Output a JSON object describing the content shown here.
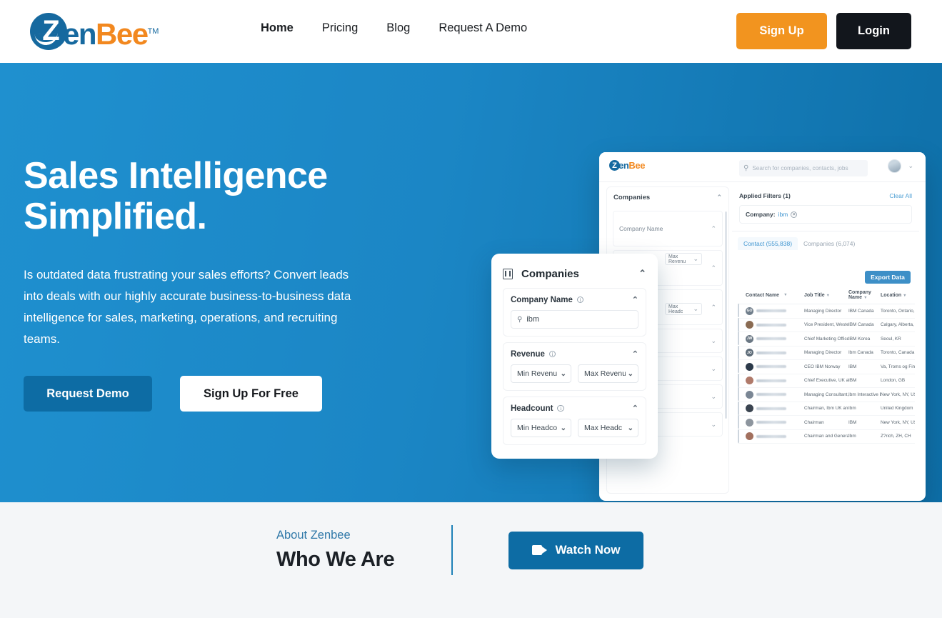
{
  "header": {
    "logo": {
      "z": "Z",
      "en": "en",
      "bee": "Bee",
      "tm": "TM"
    },
    "nav": [
      {
        "label": "Home",
        "active": true
      },
      {
        "label": "Pricing",
        "active": false
      },
      {
        "label": "Blog",
        "active": false
      },
      {
        "label": "Request A Demo",
        "active": false
      }
    ],
    "signup_label": "Sign Up",
    "login_label": "Login"
  },
  "hero": {
    "title_line1": "Sales Intelligence",
    "title_line2": "Simplified.",
    "paragraph": "Is outdated data frustrating your sales efforts? Convert leads into deals with our highly accurate business-to-business data intelligence for sales, marketing, operations, and recruiting teams.",
    "cta_primary": "Request Demo",
    "cta_secondary": "Sign Up For Free",
    "bg_color": "#1b86c5"
  },
  "mockup": {
    "logo": {
      "z": "Z",
      "en": "en",
      "bee": "Bee"
    },
    "search_placeholder": "Search for companies, contacts, jobs",
    "sidebar": {
      "title": "Companies",
      "sections": [
        {
          "label": "Company Name",
          "chev": "chevron-up"
        },
        {
          "label": "Revenue",
          "chev": "chevron-up"
        },
        {
          "label": "Headcount",
          "chev": "chevron-up"
        },
        {
          "label": "",
          "chev": "chevron-down"
        },
        {
          "label": "",
          "chev": "chevron-down"
        },
        {
          "label": "",
          "chev": "chevron-down"
        },
        {
          "label": "",
          "chev": "chevron-down"
        }
      ],
      "max_revenue_pill": "Max Revenu",
      "max_headcount_pill": "Max Headc"
    },
    "filters": {
      "applied_title": "Applied Filters (1)",
      "clear_all": "Clear All",
      "chip_label": "Company:",
      "chip_value": "ibm",
      "chip_close": "close-icon"
    },
    "tabs": [
      {
        "label": "Contact (555,838)",
        "active": true
      },
      {
        "label": "Companies (6,074)",
        "active": false
      }
    ],
    "export_label": "Export Data",
    "table": {
      "columns": [
        "Contact Name",
        "Job Title",
        "Company Name",
        "Location"
      ],
      "rows": [
        {
          "initials": "GO",
          "color": "#707e8b",
          "job": "Managing Director",
          "company": "IBM Canada",
          "location": "Toronto, Ontario, Canada"
        },
        {
          "initials": "",
          "color": "#8a6b52",
          "job": "Vice President, Western",
          "company": "IBM Canada",
          "location": "Calgary, Alberta, Canada"
        },
        {
          "initials": "JW",
          "color": "#6b7884",
          "job": "Chief Marketing Officer",
          "company": "IBM Korea",
          "location": "Seoul, KR"
        },
        {
          "initials": "JO",
          "color": "#5f6d7a",
          "job": "Managing Director",
          "company": "Ibm Canada",
          "location": "Toronto, Canada Area"
        },
        {
          "initials": "",
          "color": "#2c3a4a",
          "job": "CEO IBM Norway",
          "company": "IBM",
          "location": "Va, Troms og Finnmark, NO"
        },
        {
          "initials": "",
          "color": "#b07a6a",
          "job": "Chief Executive, UK and",
          "company": "IBM",
          "location": "London, GB"
        },
        {
          "initials": "",
          "color": "#7a8694",
          "job": "Managing Consultant, Sp",
          "company": "Ibm Interactive Expe",
          "location": "New York, NY, US"
        },
        {
          "initials": "",
          "color": "#3a4450",
          "job": "Chairman, Ibm UK and Ir",
          "company": "Ibm",
          "location": "United Kingdom"
        },
        {
          "initials": "",
          "color": "#8d959e",
          "job": "Chairman",
          "company": "IBM",
          "location": "New York, NY, US"
        },
        {
          "initials": "",
          "color": "#a2705e",
          "job": "Chairman and General M",
          "company": "Ibm",
          "location": "Z?rich, ZH, CH"
        }
      ]
    }
  },
  "filter_card": {
    "icon": "building-icon",
    "title": "Companies",
    "collapse_icon": "chevron-up",
    "sections": [
      {
        "label": "Company Name",
        "info": "info-icon",
        "chev": "chevron-up",
        "input_icon": "search-icon",
        "input_value": "ibm"
      },
      {
        "label": "Revenue",
        "info": "info-icon",
        "chev": "chevron-up",
        "select_min": "Min Revenu",
        "select_max": "Max Revenu"
      },
      {
        "label": "Headcount",
        "info": "info-icon",
        "chev": "chevron-up",
        "select_min": "Min Headco",
        "select_max": "Max Headc"
      }
    ]
  },
  "about": {
    "eyebrow": "About Zenbee",
    "title": "Who We Are",
    "watch_label": "Watch Now",
    "watch_icon": "video-camera-icon"
  }
}
